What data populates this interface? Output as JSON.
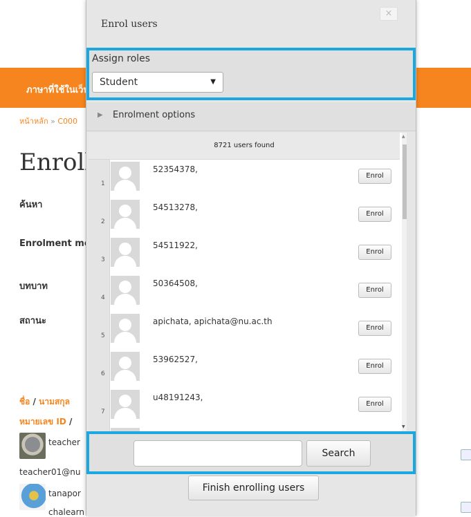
{
  "page": {
    "language_menu": "ภาษาที่ใช้ในเว็บ",
    "breadcrumb": [
      "หน้าหลัก",
      "C000"
    ],
    "breadcrumb_sep": "»",
    "title": "Enrolled users",
    "labels": {
      "search": "ค้นหา",
      "enrolment_methods": "Enrolment methods",
      "role": "บทบาท",
      "status": "สถานะ"
    },
    "sort": {
      "first_name": "ชื่อ",
      "slash": "/",
      "surname": "นามสกุล",
      "id_number": "หมายเลข ID",
      "slash2": "/"
    },
    "users": [
      {
        "name": "teacher",
        "email": "teacher01@nu"
      },
      {
        "name": "tanapor",
        "extra": "chalearn"
      }
    ]
  },
  "dialog": {
    "title": "Enrol users",
    "close_label": "×",
    "assign_roles_label": "Assign roles",
    "role_selected": "Student",
    "enrolment_options_label": "Enrolment options",
    "users_found": "8721 users found",
    "users": [
      {
        "index": "1",
        "name": "52354378,",
        "action": "Enrol"
      },
      {
        "index": "2",
        "name": "54513278,",
        "action": "Enrol"
      },
      {
        "index": "3",
        "name": "54511922,",
        "action": "Enrol"
      },
      {
        "index": "4",
        "name": "50364508,",
        "action": "Enrol"
      },
      {
        "index": "5",
        "name": "apichata, apichata@nu.ac.th",
        "action": "Enrol"
      },
      {
        "index": "6",
        "name": "53962527,",
        "action": "Enrol"
      },
      {
        "index": "7",
        "name": "u48191243,",
        "action": "Enrol"
      }
    ],
    "search_value": "",
    "search_button": "Search",
    "finish_button": "Finish enrolling users"
  },
  "colors": {
    "accent_orange": "#f7851f",
    "highlight_blue": "#1ba8e0"
  }
}
